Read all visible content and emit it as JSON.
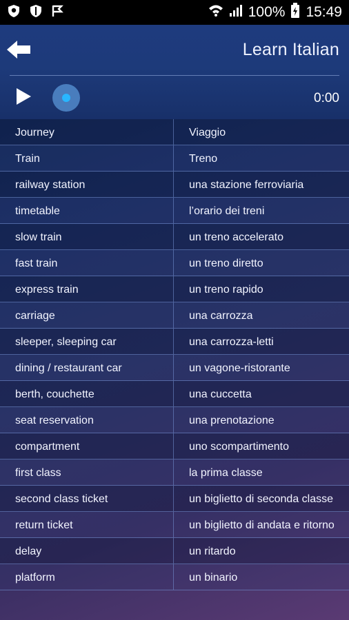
{
  "status_bar": {
    "battery": "100%",
    "time": "15:49"
  },
  "header": {
    "title": "Learn Italian"
  },
  "player": {
    "time": "0:00",
    "progress": 0
  },
  "rows": [
    {
      "en": "Journey",
      "it": "Viaggio"
    },
    {
      "en": "Train",
      "it": "Treno"
    },
    {
      "en": "railway station",
      "it": "una stazione ferroviaria"
    },
    {
      "en": "timetable",
      "it": "l’orario dei treni"
    },
    {
      "en": "slow train",
      "it": "un treno accelerato"
    },
    {
      "en": "fast train",
      "it": "un treno diretto"
    },
    {
      "en": "express train",
      "it": "un treno rapido"
    },
    {
      "en": "carriage",
      "it": "una carrozza"
    },
    {
      "en": "sleeper, sleeping car",
      "it": "una carrozza-letti"
    },
    {
      "en": "dining / restaurant car",
      "it": "un vagone-ristorante"
    },
    {
      "en": "berth, couchette",
      "it": "una cuccetta"
    },
    {
      "en": "seat reservation",
      "it": "una prenotazione"
    },
    {
      "en": "compartment",
      "it": "uno scompartimento"
    },
    {
      "en": "first class",
      "it": "la prima classe"
    },
    {
      "en": "second class ticket",
      "it": "un biglietto di seconda classe"
    },
    {
      "en": "return ticket",
      "it": "un biglietto di andata e ritorno"
    },
    {
      "en": "delay",
      "it": "un ritardo"
    },
    {
      "en": "platform",
      "it": "un binario"
    }
  ]
}
